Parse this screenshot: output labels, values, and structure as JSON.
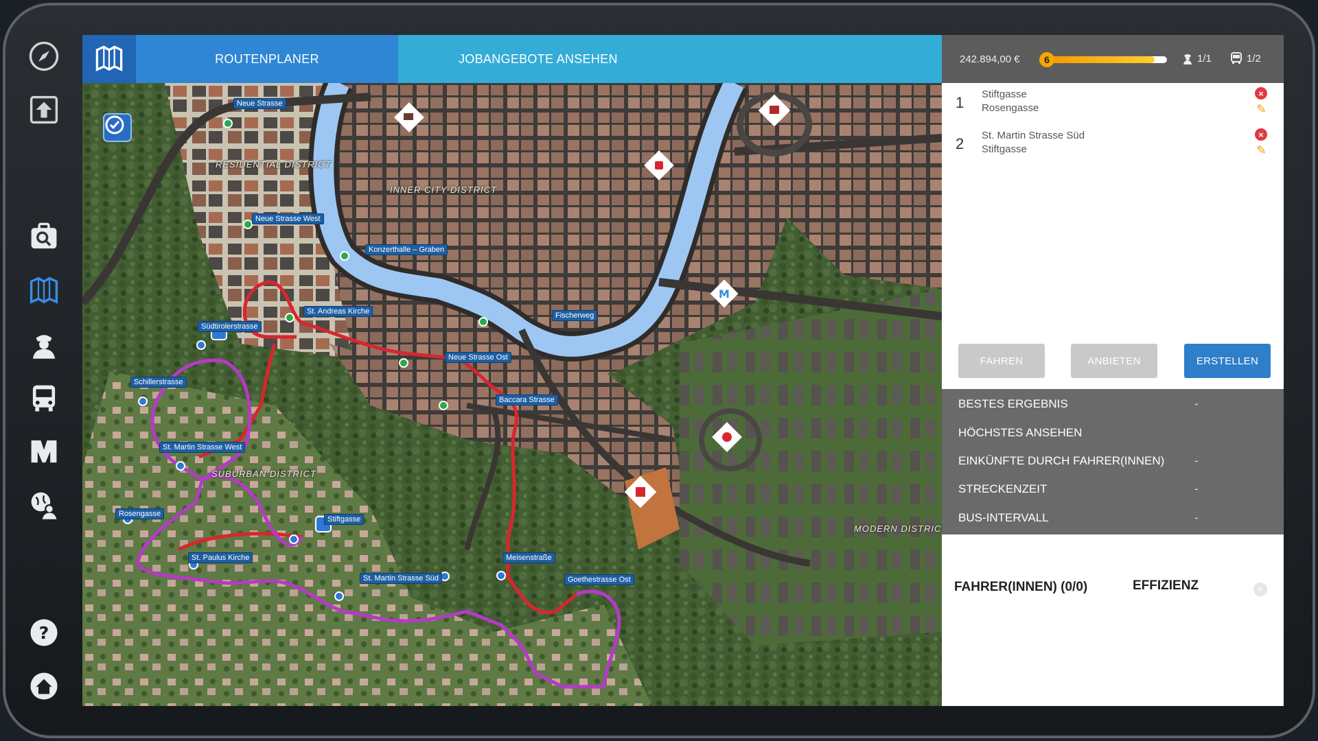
{
  "header": {
    "tab_routes": "ROUTENPLANER",
    "tab_jobs": "JOBANGEBOTE ANSEHEN",
    "money": "242.894,00 €",
    "level": "6",
    "level_progress": 0.9,
    "drivers": "1/1",
    "buses": "1/2"
  },
  "rail": {
    "icons": [
      "compass-icon",
      "exit-icon",
      "job-search-icon",
      "map-icon",
      "driver-icon",
      "bus-icon",
      "manager-icon",
      "world-icon",
      "help-icon",
      "home-icon"
    ]
  },
  "routes": [
    {
      "num": "1",
      "from": "Stiftgasse",
      "to": "Rosengasse"
    },
    {
      "num": "2",
      "from": "St. Martin Strasse Süd",
      "to": "Stiftgasse"
    }
  ],
  "buttons": {
    "fahren": "FAHREN",
    "anbieten": "ANBIETEN",
    "erstellen": "ERSTELLEN"
  },
  "stats": [
    {
      "label": "BESTES ERGEBNIS",
      "value": "-"
    },
    {
      "label": "HÖCHSTES ANSEHEN",
      "value": ""
    },
    {
      "label": "EINKÜNFTE DURCH FAHRER(INNEN)",
      "value": "-"
    },
    {
      "label": "STRECKENZEIT",
      "value": "-"
    },
    {
      "label": "BUS-INTERVALL",
      "value": "-"
    }
  ],
  "drivers_section": {
    "title": "FAHRER(INNEN) (0/0)",
    "efficiency": "EFFIZIENZ",
    "add": "+"
  },
  "map": {
    "districts": [
      "RESIDENTIAL DISTRICT",
      "INNER CITY DISTRICT",
      "SUBURBAN DISTRICT",
      "MODERN DISTRICT"
    ],
    "stops": [
      "Neue Strasse",
      "Neue Strasse West",
      "Konzerthalle – Graben",
      "St. Andreas Kirche",
      "Südtirolerstrasse",
      "Fischerweg",
      "Neue Strasse Ost",
      "Baccara Strasse",
      "Schillerstrasse",
      "St. Martin Strasse West",
      "Rosengasse",
      "Stiftgasse",
      "St. Paulus Kirche",
      "St. Martin Strasse Süd",
      "Meisenstraße",
      "Goethestrasse Ost"
    ],
    "colors": {
      "route_red": "#d8262e",
      "route_purple": "#b53ac6",
      "river": "#9dc6f2",
      "forest": "#3f5a31"
    }
  }
}
